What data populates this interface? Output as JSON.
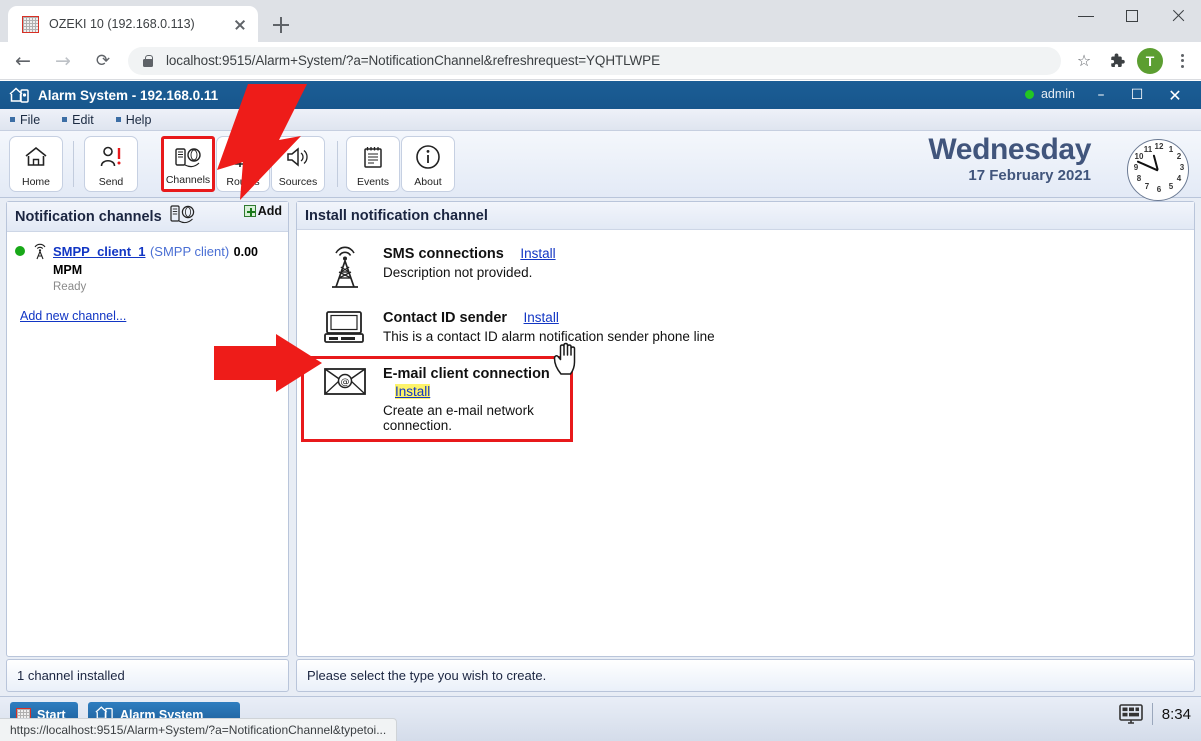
{
  "browser": {
    "tab": {
      "title": "OZEKI 10 (192.168.0.113)",
      "favicon": "grid-icon"
    },
    "newtab_label": "+",
    "nav": {
      "back": "←",
      "forward": "→",
      "reload": "⟳"
    },
    "omnibox": {
      "url": "localhost:9515/Alarm+System/?a=NotificationChannel&refreshrequest=YQHTLWPE",
      "lock": "lock-icon"
    },
    "actions": {
      "bookmark": "☆",
      "extensions": "❖",
      "profile": "T",
      "menu": "kebab-menu-icon"
    },
    "window": {
      "minimize": "minimize-icon",
      "maximize": "maximize-icon",
      "close": "close-icon"
    }
  },
  "app": {
    "title": "Alarm System - 192.168.0.11",
    "user": "admin",
    "user_status_color": "#23c723",
    "window": {
      "minimize": "–",
      "maximize": "☐",
      "close": "✕"
    },
    "menu": [
      {
        "label": "File"
      },
      {
        "label": "Edit"
      },
      {
        "label": "Help"
      }
    ],
    "toolbar": [
      {
        "label": "Home",
        "icon": "home-icon",
        "selected": false
      },
      {
        "label": "Send",
        "icon": "send-icon",
        "selected": false
      },
      {
        "label": "Channels",
        "icon": "channels-icon",
        "selected": true
      },
      {
        "label": "Routes",
        "icon": "routes-icon",
        "selected": false
      },
      {
        "label": "Sources",
        "icon": "sources-icon",
        "selected": false
      },
      {
        "label": "Events",
        "icon": "events-icon",
        "selected": false
      },
      {
        "label": "About",
        "icon": "about-icon",
        "selected": false
      }
    ],
    "date": {
      "dayname": "Wednesday",
      "full": "17 February 2021"
    },
    "clock": {
      "time": "8:34",
      "hour_angle": 255,
      "minute_angle": 204
    }
  },
  "left_panel": {
    "title": "Notification channels",
    "title_icon": "channels-icon",
    "add_label": "Add",
    "channel": {
      "status_color": "#18a818",
      "icon": "antenna-icon",
      "name": "SMPP_client_1",
      "type": "(SMPP client)",
      "rate": "0.00 MPM",
      "status": "Ready"
    },
    "add_new_link": "Add new channel...",
    "status_bar": "1 channel installed"
  },
  "right_panel": {
    "title": "Install notification channel",
    "status_bar": "Please select the type you wish to create.",
    "install_label": "Install",
    "types": [
      {
        "icon": "radio-tower-icon",
        "name": "SMS connections",
        "install": "Install",
        "description": "Description not provided.",
        "highlighted": false,
        "install_highlighted": false
      },
      {
        "icon": "desktop-computer-icon",
        "name": "Contact ID sender",
        "install": "Install",
        "description": "This is a contact ID alarm notification sender phone line",
        "highlighted": false,
        "install_highlighted": false
      },
      {
        "icon": "envelope-icon",
        "name": "E-mail client connection",
        "install": "Install",
        "description": "Create an e-mail network connection.",
        "highlighted": true,
        "install_highlighted": true
      }
    ]
  },
  "taskbar": {
    "start_label": "Start",
    "task_label": "Alarm System",
    "tray_icon": "display-icon",
    "time": "8:34"
  },
  "link_tooltip": "https://localhost:9515/Alarm+System/?a=NotificationChannel&typetoi...",
  "annotations": {
    "arrow_color": "#ee1c19",
    "highlight_color": "#e8191b",
    "install_highlight_color": "#fdf36a"
  }
}
